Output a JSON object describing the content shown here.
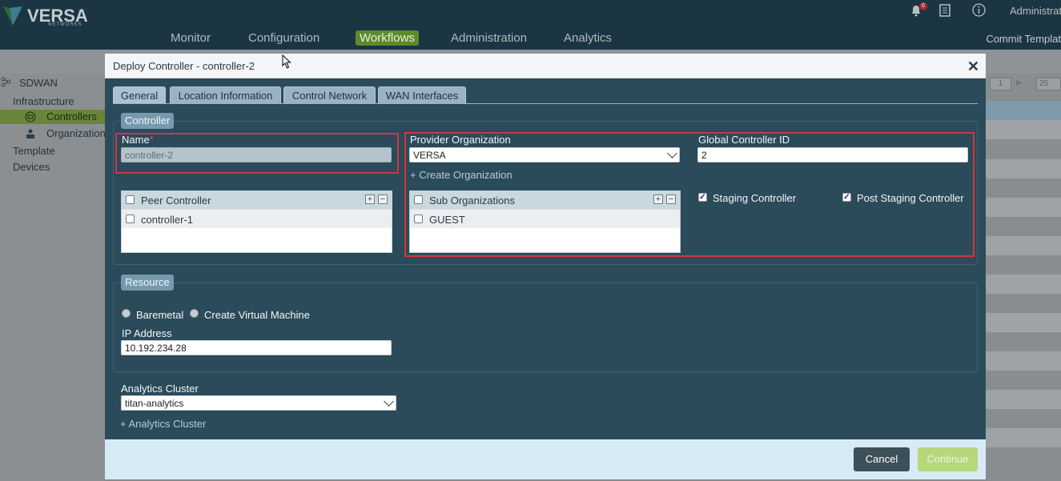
{
  "header": {
    "brand": "VERSA",
    "brand_sub": "NETWORKS",
    "nav": [
      "Monitor",
      "Configuration",
      "Workflows",
      "Administration",
      "Analytics"
    ],
    "active_nav": "Workflows",
    "notification_count": "0",
    "user": "Administrato",
    "commit": "Commit Templat"
  },
  "sidebar": {
    "root": "SDWAN",
    "items": [
      "Infrastructure",
      "Controllers",
      "Organization",
      "Template",
      "Devices"
    ],
    "selected": "Controllers"
  },
  "pager": {
    "page": "1",
    "per_page": "25"
  },
  "modal": {
    "title": "Deploy Controller - controller-2",
    "tabs": [
      "General",
      "Location Information",
      "Control Network",
      "WAN Interfaces"
    ],
    "active_tab": "General",
    "controller_section": {
      "legend": "Controller",
      "name_label": "Name",
      "required_mark": "*",
      "name_value": "controller-2",
      "peer_grid": {
        "header": "Peer Controller",
        "rows": [
          "controller-1"
        ]
      },
      "provider_org_label": "Provider Organization",
      "provider_org_value": "VERSA",
      "create_org_link": "+ Create Organization",
      "sub_org_grid": {
        "header": "Sub Organizations",
        "rows": [
          "GUEST"
        ]
      },
      "global_id_label": "Global Controller ID",
      "global_id_value": "2",
      "staging_label": "Staging Controller",
      "staging_checked": true,
      "post_staging_label": "Post Staging Controller",
      "post_staging_checked": true
    },
    "resource_section": {
      "legend": "Resource",
      "baremetal_label": "Baremetal",
      "vm_label": "Create Virtual Machine",
      "ip_label": "IP Address",
      "ip_value": "10.192.234.28"
    },
    "analytics": {
      "label": "Analytics Cluster",
      "value": "titan-analytics",
      "add_link": "+ Analytics Cluster"
    },
    "buttons": {
      "cancel": "Cancel",
      "continue": "Continue"
    }
  },
  "colors": {
    "modal_bg": "#2b4a5a",
    "accent_green": "#5d8a2a",
    "highlight_red": "#d3373a",
    "continue_button": "#b6d77a"
  }
}
